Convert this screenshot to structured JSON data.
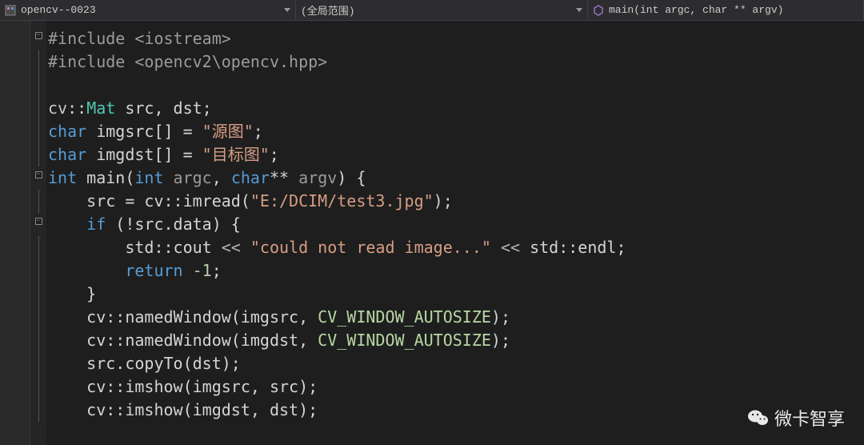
{
  "header": {
    "project_dropdown": "opencv--0023",
    "scope_dropdown": "(全局范围)",
    "function_dropdown": "main(int argc, char ** argv)"
  },
  "code": {
    "lines": [
      [
        {
          "c": "tk-pre",
          "t": "#include "
        },
        {
          "c": "tk-pre",
          "t": "<iostream>"
        }
      ],
      [
        {
          "c": "tk-pre",
          "t": "#include "
        },
        {
          "c": "tk-pre",
          "t": "<opencv2\\opencv.hpp>"
        }
      ],
      [],
      [
        {
          "c": "tk-namespace",
          "t": "cv"
        },
        {
          "c": "tk-punct",
          "t": "::"
        },
        {
          "c": "tk-type",
          "t": "Mat"
        },
        {
          "c": "tk-punct",
          "t": " src, dst;"
        }
      ],
      [
        {
          "c": "tk-key",
          "t": "char"
        },
        {
          "c": "tk-punct",
          "t": " imgsrc[] = "
        },
        {
          "c": "tk-str",
          "t": "\"源图\""
        },
        {
          "c": "tk-punct",
          "t": ";"
        }
      ],
      [
        {
          "c": "tk-key",
          "t": "char"
        },
        {
          "c": "tk-punct",
          "t": " imgdst[] = "
        },
        {
          "c": "tk-str",
          "t": "\"目标图\""
        },
        {
          "c": "tk-punct",
          "t": ";"
        }
      ],
      [
        {
          "c": "tk-key",
          "t": "int"
        },
        {
          "c": "tk-punct",
          "t": " main("
        },
        {
          "c": "tk-key",
          "t": "int"
        },
        {
          "c": "tk-param",
          "t": " argc"
        },
        {
          "c": "tk-punct",
          "t": ", "
        },
        {
          "c": "tk-key",
          "t": "char"
        },
        {
          "c": "tk-punct",
          "t": "** "
        },
        {
          "c": "tk-param",
          "t": "argv"
        },
        {
          "c": "tk-punct",
          "t": ") {"
        }
      ],
      [
        {
          "c": "tk-punct",
          "t": "    src = cv::imread("
        },
        {
          "c": "tk-str",
          "t": "\"E:/DCIM/test3.jpg\""
        },
        {
          "c": "tk-punct",
          "t": ");"
        }
      ],
      [
        {
          "c": "tk-punct",
          "t": "    "
        },
        {
          "c": "tk-key",
          "t": "if"
        },
        {
          "c": "tk-punct",
          "t": " (!src.data) {"
        }
      ],
      [
        {
          "c": "tk-punct",
          "t": "        std::cout "
        },
        {
          "c": "tk-op",
          "t": "<<"
        },
        {
          "c": "tk-punct",
          "t": " "
        },
        {
          "c": "tk-str",
          "t": "\"could not read image...\""
        },
        {
          "c": "tk-punct",
          "t": " "
        },
        {
          "c": "tk-op",
          "t": "<<"
        },
        {
          "c": "tk-punct",
          "t": " std::endl;"
        }
      ],
      [
        {
          "c": "tk-punct",
          "t": "        "
        },
        {
          "c": "tk-key",
          "t": "return"
        },
        {
          "c": "tk-punct",
          "t": " "
        },
        {
          "c": "tk-num",
          "t": "-1"
        },
        {
          "c": "tk-punct",
          "t": ";"
        }
      ],
      [
        {
          "c": "tk-punct",
          "t": "    }"
        }
      ],
      [
        {
          "c": "tk-punct",
          "t": "    cv::namedWindow(imgsrc, "
        },
        {
          "c": "tk-const",
          "t": "CV_WINDOW_AUTOSIZE"
        },
        {
          "c": "tk-punct",
          "t": ");"
        }
      ],
      [
        {
          "c": "tk-punct",
          "t": "    cv::namedWindow(imgdst, "
        },
        {
          "c": "tk-const",
          "t": "CV_WINDOW_AUTOSIZE"
        },
        {
          "c": "tk-punct",
          "t": ");"
        }
      ],
      [
        {
          "c": "tk-punct",
          "t": "    src.copyTo(dst);"
        }
      ],
      [
        {
          "c": "tk-punct",
          "t": "    cv::imshow(imgsrc, src);"
        }
      ],
      [
        {
          "c": "tk-punct",
          "t": "    cv::imshow(imgdst, dst);"
        }
      ]
    ]
  },
  "fold_markers": [
    0,
    6,
    8
  ],
  "watermark": "微卡智享"
}
